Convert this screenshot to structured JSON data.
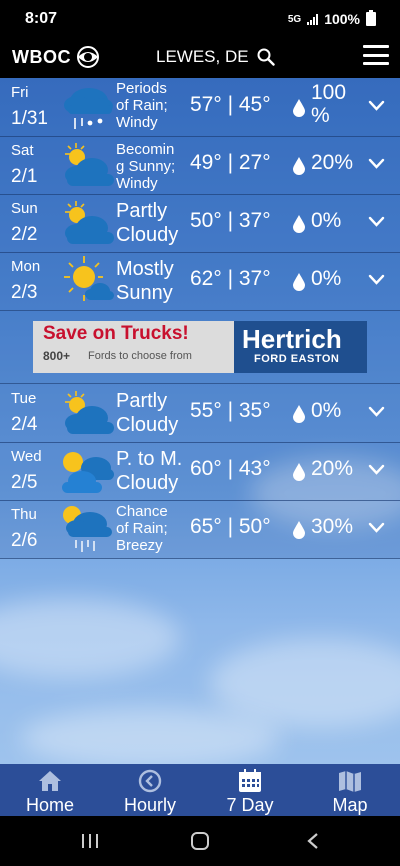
{
  "status": {
    "time": "8:07",
    "network": "5G",
    "battery": "100%"
  },
  "header": {
    "logo_text": "WBOC",
    "location": "LEWES, DE"
  },
  "days": [
    {
      "name": "Fri",
      "date": "1/31",
      "cond_lines": [
        "Periods",
        "of Rain;",
        "Windy"
      ],
      "temps": "57° | 45°",
      "precip_lines": [
        "100",
        "%"
      ],
      "icon": "rain-icon"
    },
    {
      "name": "Sat",
      "date": "2/1",
      "cond_lines": [
        "Becomin",
        "g Sunny;",
        "Windy"
      ],
      "temps": "49° | 27°",
      "precip_lines": [
        "20%"
      ],
      "icon": "partly-cloudy-icon"
    },
    {
      "name": "Sun",
      "date": "2/2",
      "cond_lines": [
        "Partly",
        "Cloudy"
      ],
      "temps": "50° | 37°",
      "precip_lines": [
        "0%"
      ],
      "icon": "partly-cloudy-icon"
    },
    {
      "name": "Mon",
      "date": "2/3",
      "cond_lines": [
        "Mostly",
        "Sunny"
      ],
      "temps": "62° | 37°",
      "precip_lines": [
        "0%"
      ],
      "icon": "mostly-sunny-icon"
    },
    {
      "name": "Tue",
      "date": "2/4",
      "cond_lines": [
        "Partly",
        "Cloudy"
      ],
      "temps": "55° | 35°",
      "precip_lines": [
        "0%"
      ],
      "icon": "partly-cloudy-icon"
    },
    {
      "name": "Wed",
      "date": "2/5",
      "cond_lines": [
        "P. to M.",
        "Cloudy"
      ],
      "temps": "60° | 43°",
      "precip_lines": [
        "20%"
      ],
      "icon": "mostly-cloudy-icon"
    },
    {
      "name": "Thu",
      "date": "2/6",
      "cond_lines": [
        "Chance",
        "of Rain;",
        "Breezy"
      ],
      "temps": "65° | 50°",
      "precip_lines": [
        "30%"
      ],
      "icon": "chance-rain-icon"
    }
  ],
  "ad": {
    "headline": "Save on Trucks!",
    "sub_number": "800+",
    "sub_text": "Fords to choose from",
    "brand": "Hertrich",
    "brand_sub": "FORD EASTON"
  },
  "nav": {
    "home": "Home",
    "hourly": "Hourly",
    "seven_day": "7 Day",
    "map": "Map"
  },
  "colors": {
    "nav_bg": "#2c4e98",
    "ad_red": "#c8102e",
    "ad_blue": "#1f4f8f"
  }
}
